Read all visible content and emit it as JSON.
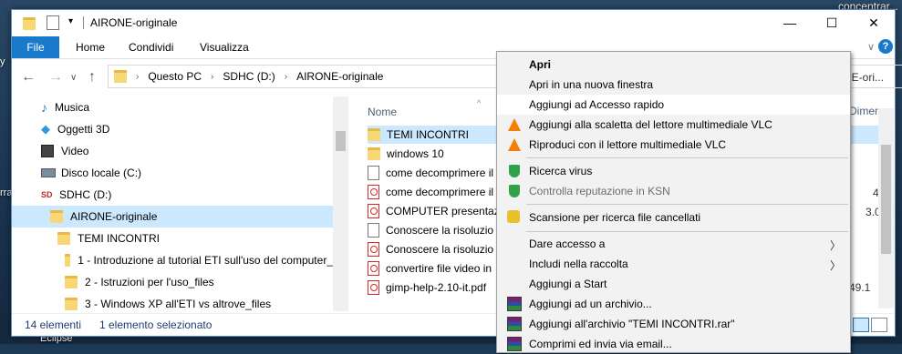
{
  "desktop": {
    "top_right_text": "concentrar...",
    "left_text": "rra",
    "left_text2": "y",
    "bottom_text": "Eclipse"
  },
  "window": {
    "title": "AIRONE-originale",
    "controls": {
      "minimize": "—",
      "maximize": "☐",
      "close": "✕"
    }
  },
  "ribbon": {
    "tabs": [
      "File",
      "Home",
      "Condividi",
      "Visualizza"
    ]
  },
  "address": {
    "crumbs": [
      "Questo PC",
      "SDHC (D:)",
      "AIRONE-originale"
    ],
    "search_fragment": "NE-ori..."
  },
  "nav": {
    "items": [
      {
        "label": "Musica",
        "icon": "music-note-icon"
      },
      {
        "label": "Oggetti 3D",
        "icon": "cube-3d-icon"
      },
      {
        "label": "Video",
        "icon": "film-icon"
      },
      {
        "label": "Disco locale (C:)",
        "icon": "drive-icon"
      },
      {
        "label": "SDHC (D:)",
        "icon": "sd-card-icon"
      },
      {
        "label": "AIRONE-originale",
        "icon": "folder-icon"
      },
      {
        "label": "TEMI INCONTRI",
        "icon": "folder-icon"
      },
      {
        "label": "1 - Introduzione al tutorial ETI sull'uso del computer_",
        "icon": "folder-icon"
      },
      {
        "label": "2 - Istruzioni per l'uso_files",
        "icon": "folder-icon"
      },
      {
        "label": "3 - Windows XP all'ETI vs altrove_files",
        "icon": "folder-icon"
      }
    ]
  },
  "content": {
    "column_name": "Nome",
    "column_size_fragment": "Dimen",
    "files": [
      {
        "label": "TEMI INCONTRI",
        "type": "folder"
      },
      {
        "label": "windows 10",
        "type": "folder"
      },
      {
        "label": "come decomprimere il",
        "type": "doc"
      },
      {
        "label": "come decomprimere il",
        "type": "pdf"
      },
      {
        "label": "COMPUTER presentazio",
        "type": "pdf"
      },
      {
        "label": "Conoscere la risoluzio",
        "type": "doc"
      },
      {
        "label": "Conoscere la risoluzio",
        "type": "pdf"
      },
      {
        "label": "convertire file video in",
        "type": "pdf"
      },
      {
        "label": "gimp-help-2.10-it.pdf",
        "type": "pdf"
      }
    ],
    "right_values": [
      "4",
      "3.0",
      "49.1"
    ]
  },
  "status": {
    "count": "14 elementi",
    "selection": "1 elemento selezionato"
  },
  "context_menu": {
    "items": [
      {
        "label": "Apri",
        "bold": true
      },
      {
        "label": "Apri in una nuova finestra"
      },
      {
        "label": "Aggiungi ad Accesso rapido",
        "hover": true
      },
      {
        "label": "Aggiungi alla scaletta del lettore multimediale VLC",
        "icon": "vlc-icon"
      },
      {
        "label": "Riproduci con il lettore multimediale VLC",
        "icon": "vlc-icon"
      },
      {
        "label": "Ricerca virus",
        "icon": "shield-icon"
      },
      {
        "label": "Controlla reputazione in KSN",
        "icon": "shield-icon",
        "disabled": true
      },
      {
        "label": "Scansione per ricerca file cancellati",
        "icon": "scan-icon"
      },
      {
        "label": "Dare accesso a",
        "submenu": true
      },
      {
        "label": "Includi nella raccolta",
        "submenu": true
      },
      {
        "label": "Aggiungi a Start"
      },
      {
        "label": "Aggiungi ad un archivio...",
        "icon": "winrar-icon"
      },
      {
        "label": "Aggiungi all'archivio \"TEMI INCONTRI.rar\"",
        "icon": "winrar-icon"
      },
      {
        "label": "Comprimi ed invia via email...",
        "icon": "winrar-icon"
      }
    ]
  },
  "colors": {
    "accent": "#1979ca",
    "selection": "#cce8ff",
    "folder": "#f8d775"
  }
}
